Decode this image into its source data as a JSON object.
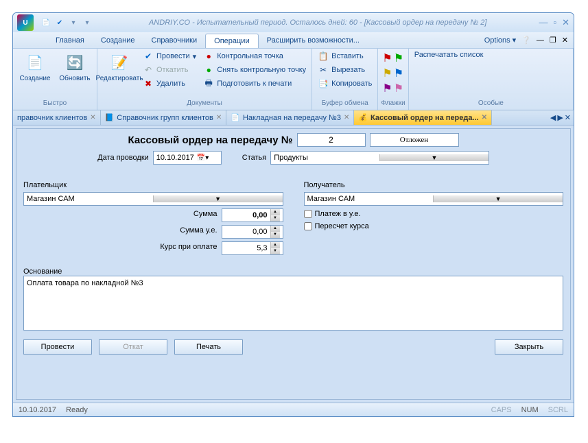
{
  "title": "ANDRIY.CO - Испытательный период. Осталось дней: 60 - [Кассовый ордер на передачу № 2]",
  "menu": {
    "items": [
      "Главная",
      "Создание",
      "Справочники",
      "Операции",
      "Расширить возможности..."
    ],
    "options": "Options"
  },
  "ribbon": {
    "quick": {
      "title": "Быстро",
      "create": "Создание",
      "refresh": "Обновить"
    },
    "docs": {
      "title": "Документы",
      "edit": "Редактировать",
      "post": "Провести",
      "rollback": "Откатить",
      "delete": "Удалить",
      "checkpoint": "Контрольная точка",
      "unchk": "Снять контрольную точку",
      "prep": "Подготовить к печати"
    },
    "clip": {
      "title": "Буфер обмена",
      "paste": "Вставить",
      "cut": "Вырезать",
      "copy": "Копировать"
    },
    "flags": {
      "title": "Флажки"
    },
    "special": {
      "title": "Особые",
      "print_list": "Распечатать список"
    }
  },
  "tabs": [
    {
      "label": "правочник клиентов"
    },
    {
      "label": "Справочник групп клиентов"
    },
    {
      "label": "Накладная на передачу №3"
    },
    {
      "label": "Кассовый ордер на переда..."
    }
  ],
  "form": {
    "heading": "Кассовый ордер на передачу №",
    "number": "2",
    "status": "Отложен",
    "date_label": "Дата проводки",
    "date": "10.10.2017",
    "article_label": "Статья",
    "article": "Продукты",
    "payer_label": "Плательщик",
    "payer": "Магазин САМ",
    "receiver_label": "Получатель",
    "receiver": "Магазин САМ",
    "sum_label": "Сумма",
    "sum": "0,00",
    "sum_ue_label": "Сумма у.е.",
    "sum_ue": "0,00",
    "rate_label": "Курс при оплате",
    "rate": "5,3",
    "pay_ue": "Платеж в у.е.",
    "recalc": "Пересчет курса",
    "basis_label": "Основание",
    "basis": "Оплата товара по накладной №3",
    "btn_post": "Провести",
    "btn_rollback": "Откат",
    "btn_print": "Печать",
    "btn_close": "Закрыть"
  },
  "status": {
    "date": "10.10.2017",
    "ready": "Ready",
    "caps": "CAPS",
    "num": "NUM",
    "scrl": "SCRL"
  }
}
